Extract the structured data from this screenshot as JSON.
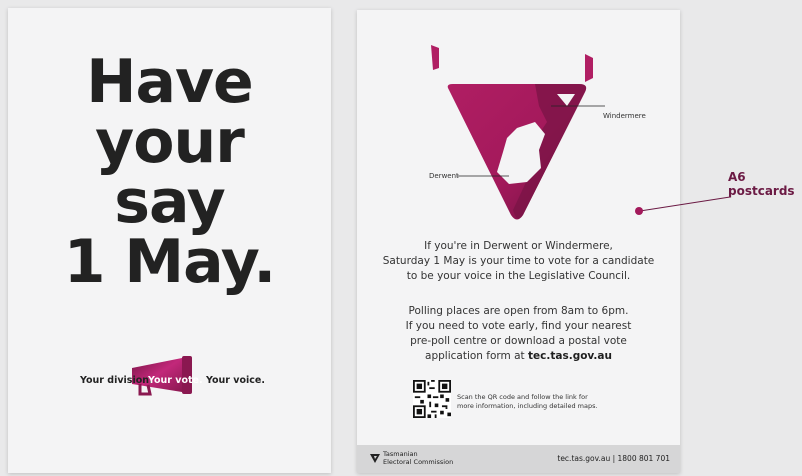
{
  "front": {
    "headline": [
      "Have",
      "your",
      "say",
      "1 May."
    ],
    "tagline": {
      "left": "Your division.",
      "middle": "Your vote.",
      "right": "Your voice."
    }
  },
  "back": {
    "map_labels": {
      "derwent": "Derwent",
      "windermere": "Windermere"
    },
    "paragraph1": [
      "If you're in Derwent or Windermere,",
      "Saturday 1 May is your time to vote for a candidate",
      "to be your voice in the Legislative Council."
    ],
    "paragraph2": [
      "Polling places are open from 8am to 6pm.",
      "If you need to vote early, find your nearest",
      "pre-poll centre or download a postal vote",
      "application form at "
    ],
    "paragraph2_link": "tec.tas.gov.au",
    "qr_text": [
      "Scan the QR code and follow the link for",
      "more information, including detailed maps."
    ],
    "footer": {
      "org_line1": "Tasmanian",
      "org_line2": "Electoral Commission",
      "contact": "tec.tas.gov.au | 1800 801 701"
    }
  },
  "annotation": {
    "line1": "A6",
    "line2": "postcards"
  },
  "colors": {
    "brand": "#a3195b",
    "brand_dark": "#6b1a44"
  }
}
